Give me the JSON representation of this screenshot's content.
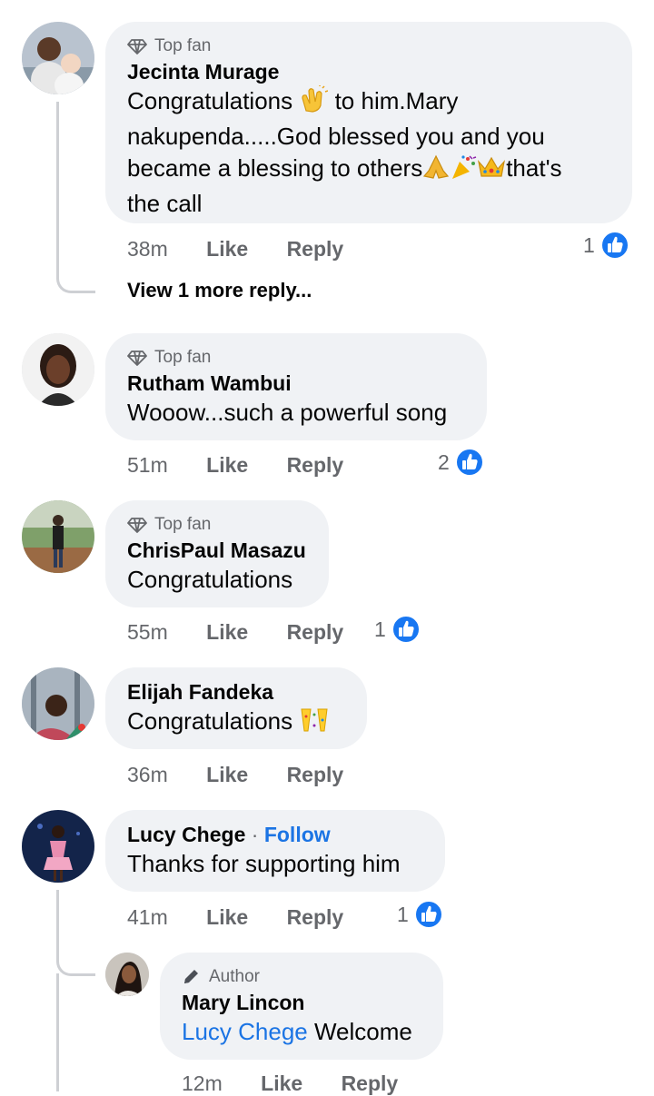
{
  "comments": [
    {
      "author": "Jecinta Murage",
      "badge": "Top fan",
      "lines": [
        "Congratulations",
        " to him.Mary",
        "nakupenda.....God blessed you and you",
        "became a blessing to others",
        "that's",
        "the call"
      ],
      "time": "38m",
      "like": "Like",
      "reply": "Reply",
      "reactions": "1",
      "view_replies": "View 1 more reply..."
    },
    {
      "author": "Rutham Wambui",
      "badge": "Top fan",
      "text": "Wooow...such a powerful song",
      "time": "51m",
      "like": "Like",
      "reply": "Reply",
      "reactions": "2"
    },
    {
      "author": "ChrisPaul Masazu",
      "badge": "Top fan",
      "text": "Congratulations",
      "time": "55m",
      "like": "Like",
      "reply": "Reply",
      "reactions": "1"
    },
    {
      "author": "Elijah Fandeka",
      "text": "Congratulations",
      "time": "36m",
      "like": "Like",
      "reply": "Reply"
    },
    {
      "author": "Lucy Chege",
      "follow": "Follow",
      "separator": "·",
      "text": "Thanks for supporting him",
      "time": "41m",
      "like": "Like",
      "reply": "Reply",
      "reactions": "1"
    }
  ],
  "reply": {
    "author": "Mary Lincon",
    "badge": "Author",
    "mention": "Lucy Chege",
    "text": " Welcome",
    "time": "12m",
    "like": "Like",
    "reply": "Reply"
  },
  "icons": {
    "top_fan": "diamond-icon",
    "author": "pencil-icon",
    "reaction": "like-thumbs-up-icon"
  },
  "colors": {
    "link": "#1b74e4",
    "bubble": "#f0f2f5",
    "meta": "#65676b"
  }
}
